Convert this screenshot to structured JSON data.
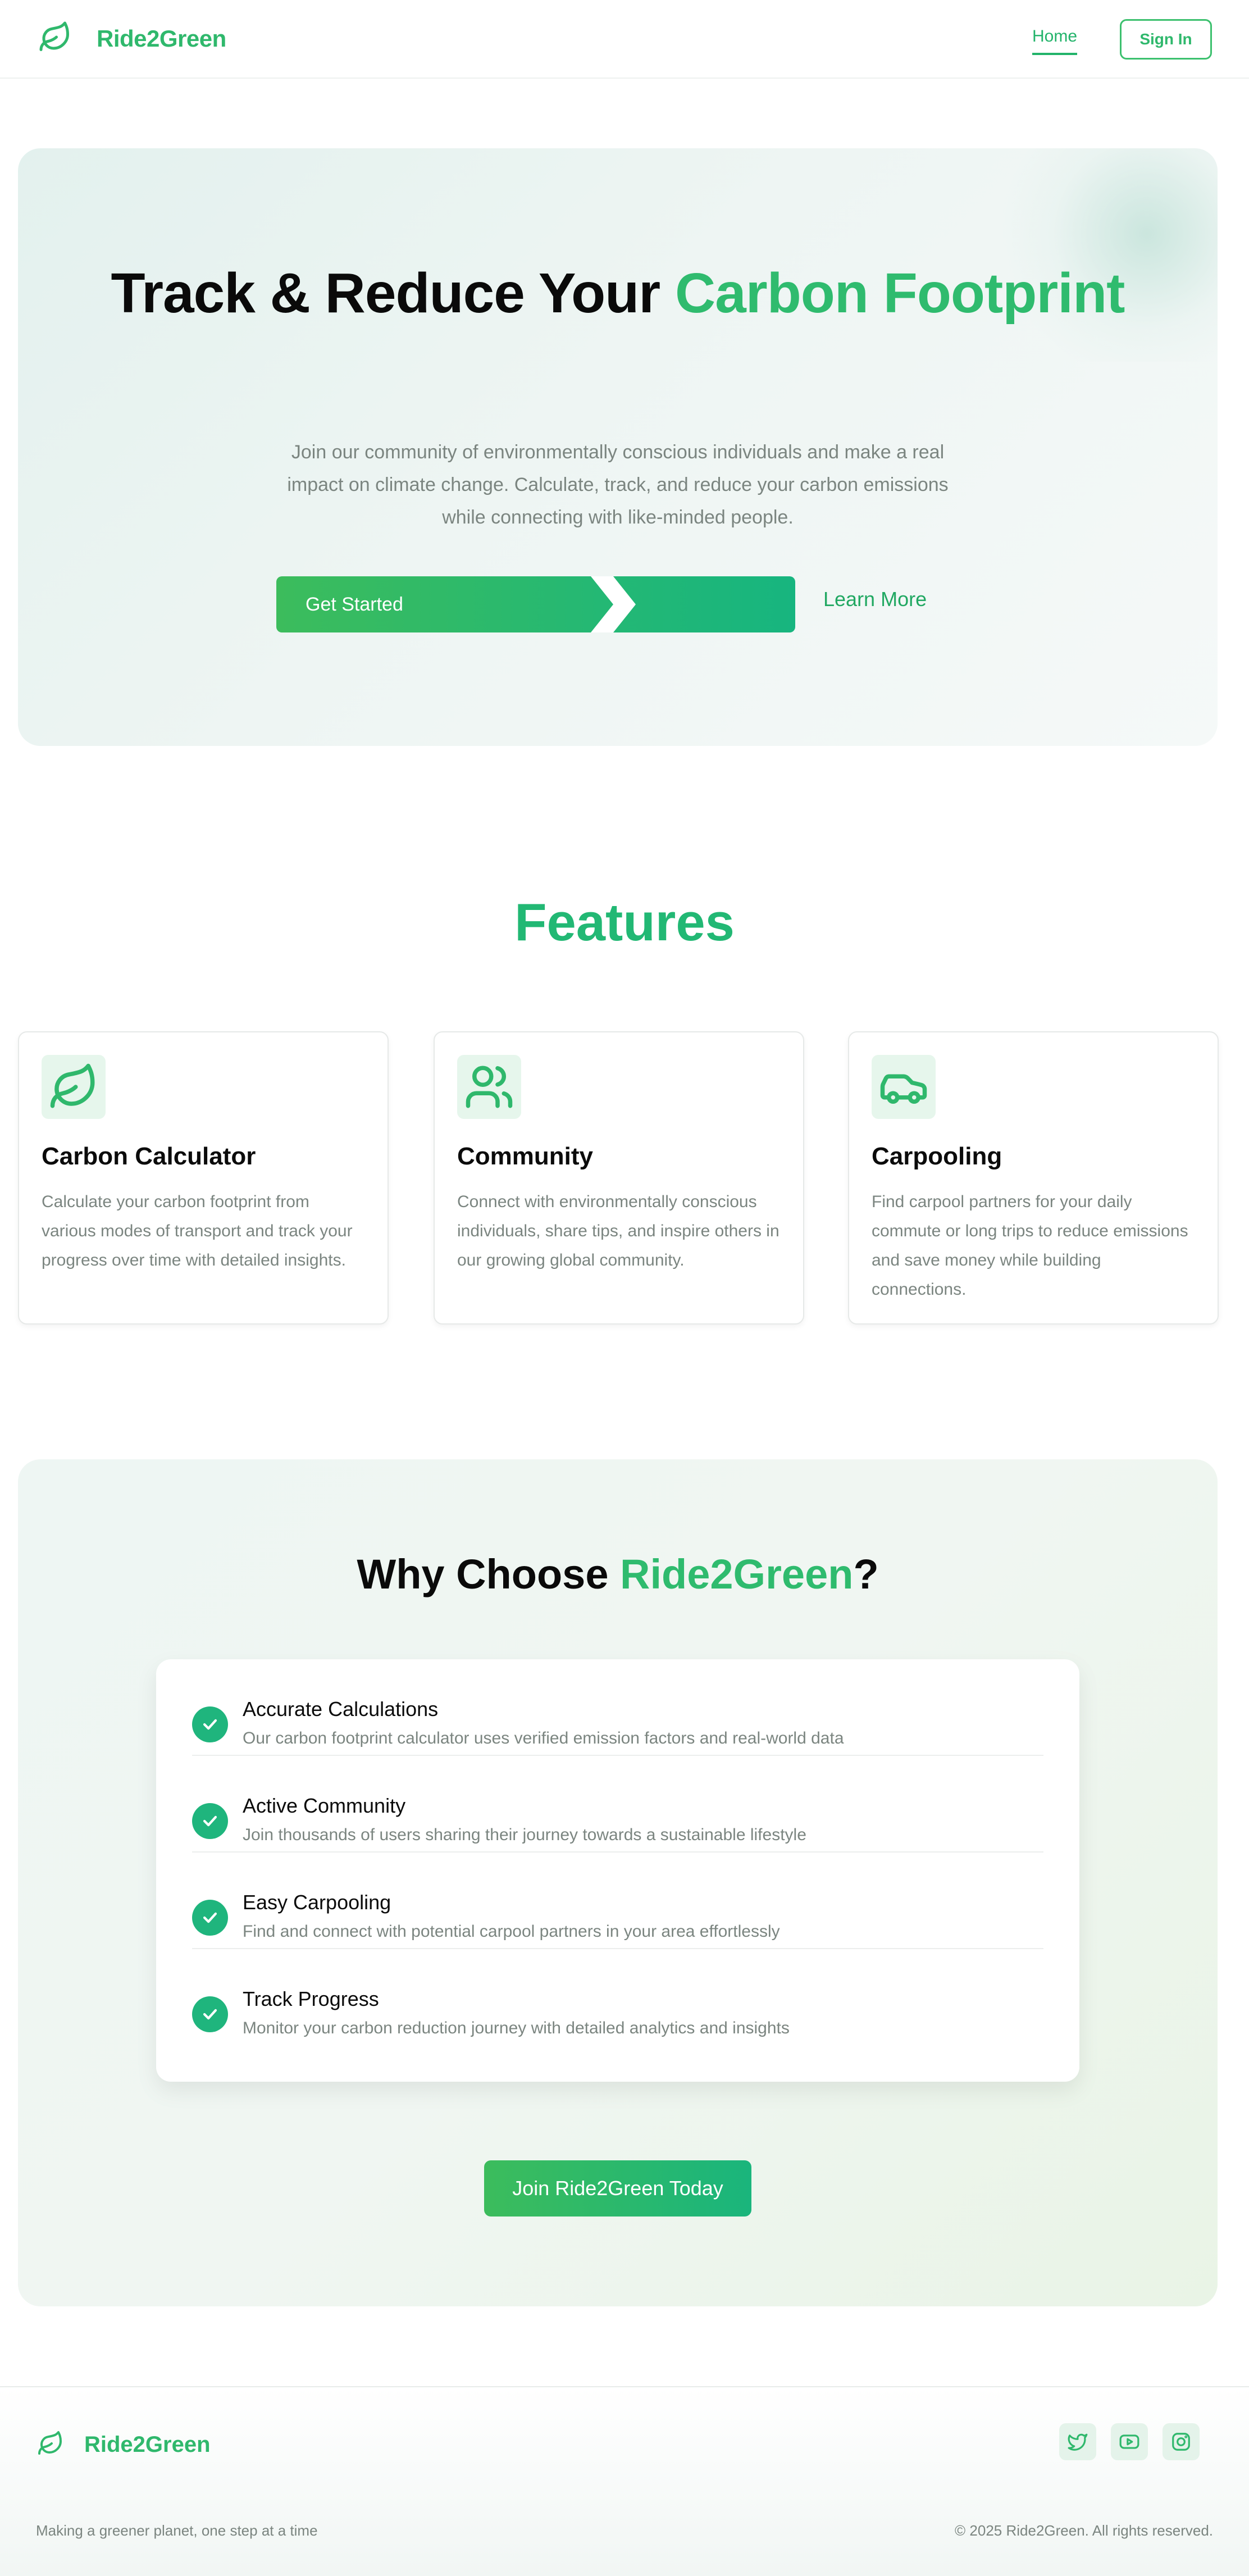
{
  "nav": {
    "brand": "Ride2Green",
    "home": "Home",
    "signin": "Sign In",
    "logo_icon": "leaf-icon"
  },
  "hero": {
    "title_black": "Track & Reduce Your ",
    "title_green": "Carbon Footprint",
    "subtitle": "Join our community of environmentally conscious individuals and make a real impact on climate change. Calculate, track, and reduce your carbon emissions while connecting with like-minded people.",
    "cta_primary": "Get Started",
    "cta_secondary": "Learn More"
  },
  "features": {
    "title": "Features",
    "cards": [
      {
        "title": "Carbon Calculator",
        "text": "Calculate your carbon footprint from various modes of transport and track your progress over time with detailed insights.",
        "icon": "leaf-icon"
      },
      {
        "title": "Community",
        "text": "Connect with environmentally conscious individuals, share tips, and inspire others in our growing global community.",
        "icon": "users-icon"
      },
      {
        "title": "Carpooling",
        "text": "Find carpool partners for your daily commute or long trips to reduce emissions and save money while building connections.",
        "icon": "car-icon"
      }
    ]
  },
  "why": {
    "title_pre": "Why Choose ",
    "title_brand": "Ride2Green",
    "title_post": "?",
    "items": [
      {
        "title": "Accurate Calculations",
        "desc": "Our carbon footprint calculator uses verified emission factors and real-world data"
      },
      {
        "title": "Active Community",
        "desc": "Join thousands of users sharing their journey towards a sustainable lifestyle"
      },
      {
        "title": "Easy Carpooling",
        "desc": "Find and connect with potential carpool partners in your area effortlessly"
      },
      {
        "title": "Track Progress",
        "desc": "Monitor your carbon reduction journey with detailed analytics and insights"
      }
    ],
    "cta": "Join Ride2Green Today"
  },
  "footer": {
    "brand": "Ride2Green",
    "tagline": "Making a greener planet, one step at a time",
    "copyright": "© 2025 Ride2Green. All rights reserved.",
    "social": [
      "twitter-icon",
      "youtube-icon",
      "instagram-icon"
    ]
  },
  "colors": {
    "brand_green": "#2fb86c",
    "accent_teal": "#1ab57c",
    "muted_text": "#7b8580"
  }
}
